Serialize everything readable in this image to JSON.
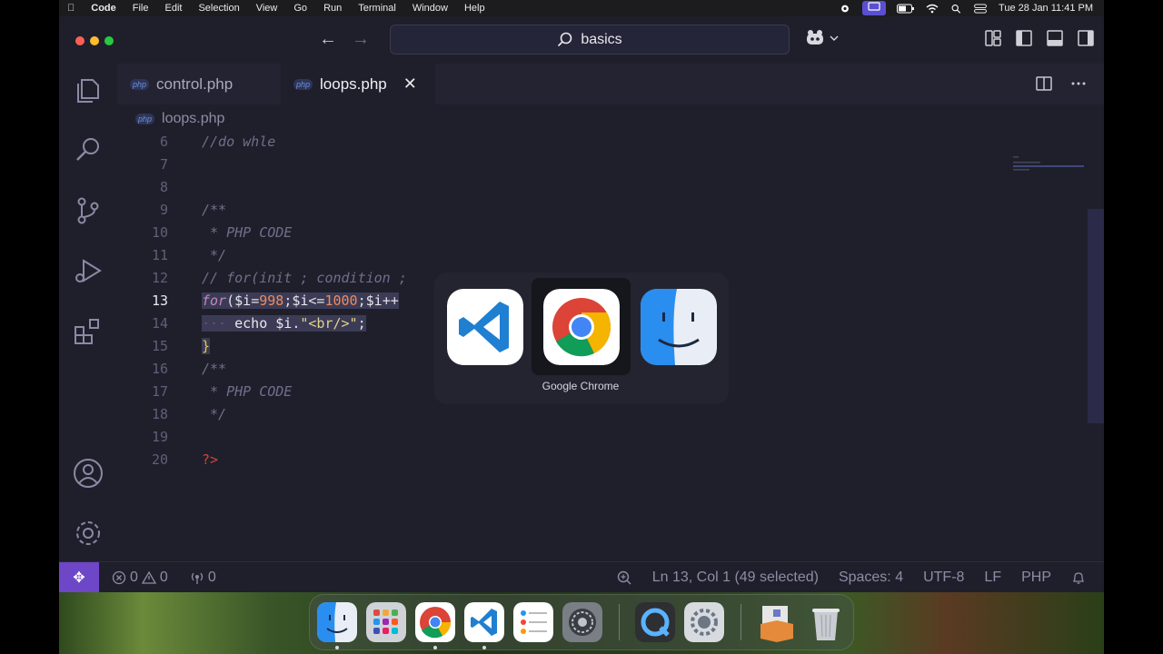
{
  "menubar": {
    "app_name": "Code",
    "items": [
      "File",
      "Edit",
      "Selection",
      "View",
      "Go",
      "Run",
      "Terminal",
      "Window",
      "Help"
    ],
    "clock": "Tue 28 Jan  11:41 PM"
  },
  "titlebar": {
    "search_text": "basics"
  },
  "tabs": [
    {
      "badge": "php",
      "label": "control.php"
    },
    {
      "badge": "php",
      "label": "loops.php"
    }
  ],
  "breadcrumb": {
    "badge": "php",
    "file": "loops.php"
  },
  "code": {
    "current_line": "13",
    "lines": [
      {
        "n": "6"
      },
      {
        "n": "7"
      },
      {
        "n": "8"
      },
      {
        "n": "9"
      },
      {
        "n": "10"
      },
      {
        "n": "11"
      },
      {
        "n": "12"
      },
      {
        "n": "13"
      },
      {
        "n": "14"
      },
      {
        "n": "15"
      },
      {
        "n": "16"
      },
      {
        "n": "17"
      },
      {
        "n": "18"
      },
      {
        "n": "19"
      },
      {
        "n": "20"
      }
    ],
    "l6": "//do whle",
    "l9": "/**",
    "l10": " * PHP CODE",
    "l11": " */",
    "l12": "// for(init ; condition ;",
    "l13_for": "for",
    "l13_open": "(",
    "l13_var1": "$i",
    "l13_eq": "=",
    "l13_num1": "998",
    "l13_semi1": ";",
    "l13_var2": "$i",
    "l13_le": "<=",
    "l13_num2": "1000",
    "l13_semi2": ";",
    "l13_var3": "$i",
    "l13_inc": "++",
    "l14_indent": "···",
    "l14_echo": "echo",
    "l14_var": "$i",
    "l14_dot": ".",
    "l14_str": "\"<br/>\"",
    "l14_semi": ";",
    "l15": "}",
    "l16": "/**",
    "l17": " * PHP CODE",
    "l18": " */",
    "l20": "?>"
  },
  "switcher": {
    "selected_label": "Google Chrome",
    "apps": [
      "vscode-icon",
      "chrome-icon",
      "finder-icon"
    ]
  },
  "statusbar": {
    "errors": "0",
    "warnings": "0",
    "ports": "0",
    "position": "Ln 13, Col 1 (49 selected)",
    "spaces": "Spaces: 4",
    "encoding": "UTF-8",
    "eol": "LF",
    "language": "PHP"
  },
  "dock": {
    "apps": [
      "finder-icon",
      "launchpad-icon",
      "chrome-icon",
      "vscode-icon",
      "reminders-icon",
      "system-settings-icon",
      "quicktime-icon",
      "settings-gear-icon",
      "archive-utility-icon",
      "trash-icon"
    ]
  },
  "colors": {
    "accent": "#6e47c8",
    "editor_bg": "#1f1f2b",
    "number": "#f08a5d",
    "keyword": "#c586c0",
    "string": "#e3d28a"
  }
}
